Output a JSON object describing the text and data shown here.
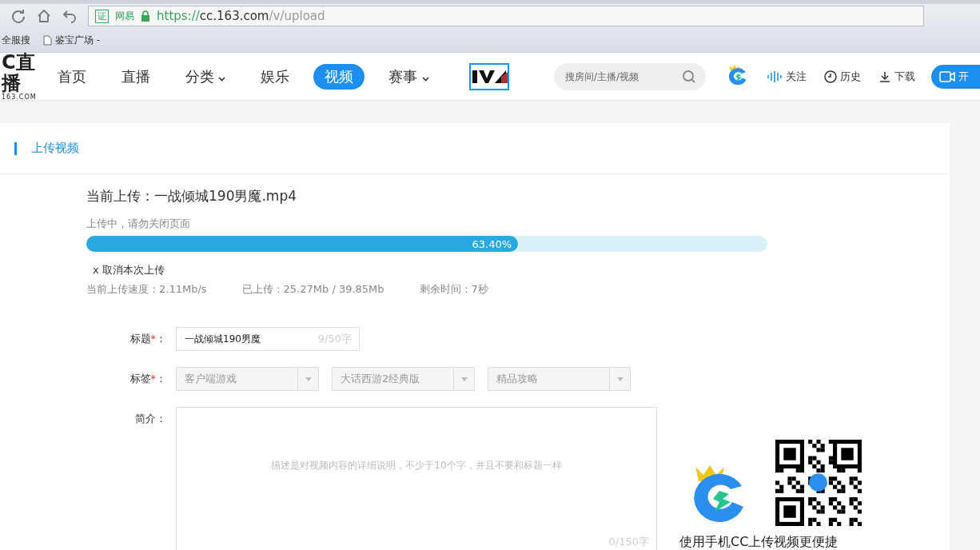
{
  "browser": {
    "site_badge": "证",
    "site_name": "网易",
    "url_scheme": "https://",
    "url_host": "cc.163.com",
    "url_path": "/v/upload",
    "bookmarks": [
      "全服搜",
      "鉴宝广场 -"
    ]
  },
  "nav": {
    "logo": "C直播",
    "logo_sub": "163.COM",
    "items": [
      {
        "label": "首页",
        "selected": false,
        "dropdown": false
      },
      {
        "label": "直播",
        "selected": false,
        "dropdown": false
      },
      {
        "label": "分类",
        "selected": false,
        "dropdown": true
      },
      {
        "label": "娱乐",
        "selected": false,
        "dropdown": false
      },
      {
        "label": "视频",
        "selected": true,
        "dropdown": false
      },
      {
        "label": "赛事",
        "selected": false,
        "dropdown": true
      }
    ],
    "search": {
      "placeholder": "搜房间/主播/视频"
    },
    "actions": [
      {
        "kind": "follow",
        "label": "关注"
      },
      {
        "kind": "history",
        "label": "历史"
      },
      {
        "kind": "download",
        "label": "下载"
      }
    ],
    "live_button": "开"
  },
  "panel": {
    "title": "上传视频"
  },
  "upload": {
    "current": "当前上传：一战倾城190男魔.mp4",
    "status": "上传中，请勿关闭页面",
    "level": 0.634,
    "percent": "63.40%",
    "cancel": "x 取消本次上传",
    "stats": [
      "当前上传速度：2.11Mb/s",
      "已上传：25.27Mb / 39.85Mb",
      "剩余时间：7秒"
    ]
  },
  "form": {
    "required_mark": "*",
    "colon": "：",
    "title": {
      "label": "标题",
      "required": true,
      "value": "一战倾城190男魔",
      "counter": "9/50字"
    },
    "tags": {
      "label": "标签",
      "required": true,
      "options": [
        "客户端游戏",
        "大话西游2经典版",
        "精品攻略"
      ]
    },
    "intro": {
      "label": "简介",
      "required": false,
      "placeholder": "描述是对视频内容的详细说明，不少于10个字，并且不要和标题一样",
      "counter": "0/150字"
    }
  },
  "promo": {
    "text": "使用手机CC上传视频更便捷"
  }
}
